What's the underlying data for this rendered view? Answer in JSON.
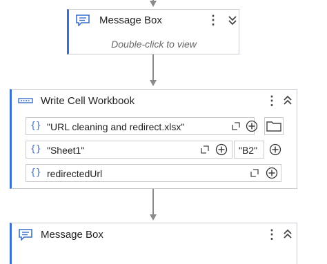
{
  "activities": {
    "message_box_1": {
      "title": "Message Box",
      "hint": "Double-click to view"
    },
    "write_cell": {
      "title": "Write Cell Workbook",
      "workbook_path": "\"URL cleaning and redirect.xlsx\"",
      "sheet_name": "\"Sheet1\"",
      "cell": "\"B2\"",
      "value": "redirectedUrl"
    },
    "message_box_2": {
      "title": "Message Box"
    }
  },
  "labels": {
    "brace": "{}",
    "kebab": "⋮"
  },
  "icons": {
    "message": "message-box-icon",
    "write_cell": "write-cell-icon",
    "expand": "expand-editor-icon",
    "plus": "plus-circle-icon",
    "folder": "folder-icon",
    "chevron_down": "double-chevron-down-icon",
    "chevron_up": "double-chevron-up-icon"
  },
  "colors": {
    "accent": "#3b6fc9",
    "connector": "#8a8a8a",
    "border": "#c8ccd0"
  }
}
